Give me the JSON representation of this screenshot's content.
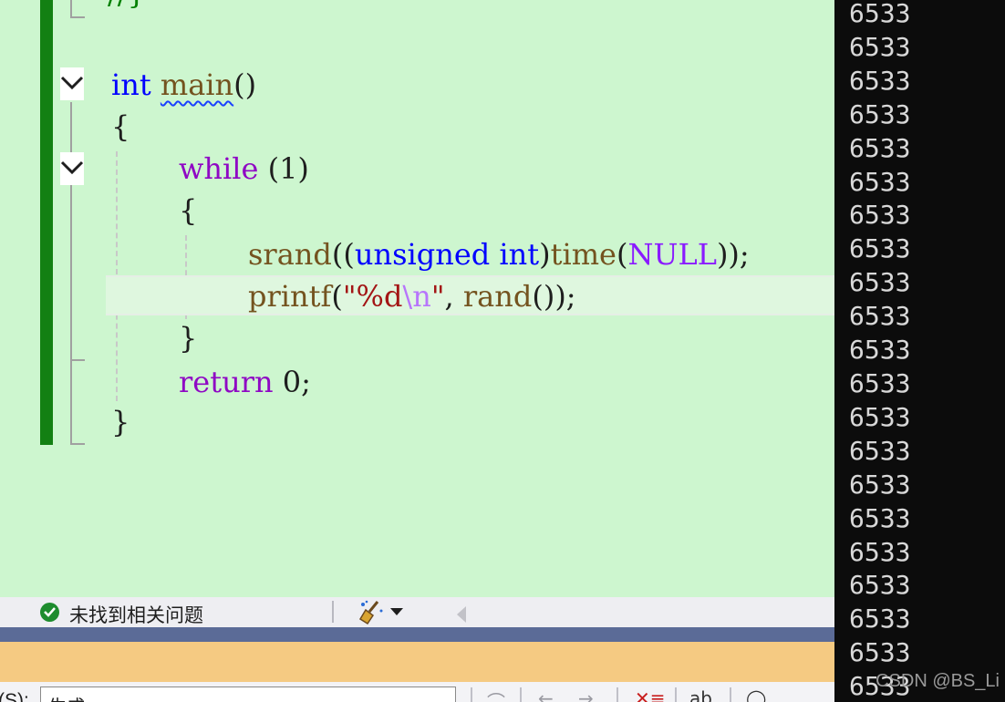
{
  "editor": {
    "top_comment": "//}",
    "func_return_type": "int",
    "func_name": "main",
    "func_parens": "()",
    "brace_open": "{",
    "while_kw": "while",
    "while_cond": " (1)",
    "inner_brace_open": "{",
    "srand_fn": "srand",
    "srand_p1": "((",
    "cast_type1": "unsigned",
    "cast_type2": "int",
    "cast_close": ")",
    "time_fn": "time",
    "time_open": "(",
    "null_macro": "NULL",
    "srand_end": "));",
    "printf_fn": "printf",
    "printf_open": "(",
    "fmt_str": "\"%d",
    "fmt_esc": "\\n",
    "fmt_end": "\"",
    "printf_comma": ", ",
    "rand_fn": "rand",
    "printf_end": "());",
    "inner_brace_close": "}",
    "return_kw": "return",
    "return_val": " 0;",
    "brace_close": "}"
  },
  "status": {
    "message": "未找到相关问题"
  },
  "panel": {
    "show_label": "(S):",
    "source_value": "生成"
  },
  "console": {
    "lines": [
      "6533",
      "6533",
      "6533",
      "6533",
      "6533",
      "6533",
      "6533",
      "6533",
      "6533",
      "6533",
      "6533",
      "6533",
      "6533",
      "6533",
      "6533",
      "6533",
      "6533",
      "6533",
      "6533",
      "6533",
      "6533"
    ]
  },
  "watermark": "CSDN @BS_Li",
  "colors": {
    "editor_bg": "#cdf6cf",
    "change_bar": "#138013",
    "keyword_blue": "#0000ff",
    "keyword_purple": "#8f08c4",
    "function": "#74531f",
    "string": "#a31515",
    "console_bg": "#0c0c0c",
    "panel_header": "#f5ca82",
    "tab_bar": "#5b6b97"
  },
  "icons": [
    "fold-chevron-icon",
    "check-circle-icon",
    "code-cleanup-broom-icon",
    "dropdown-arrow-icon",
    "nav-left-icon"
  ]
}
